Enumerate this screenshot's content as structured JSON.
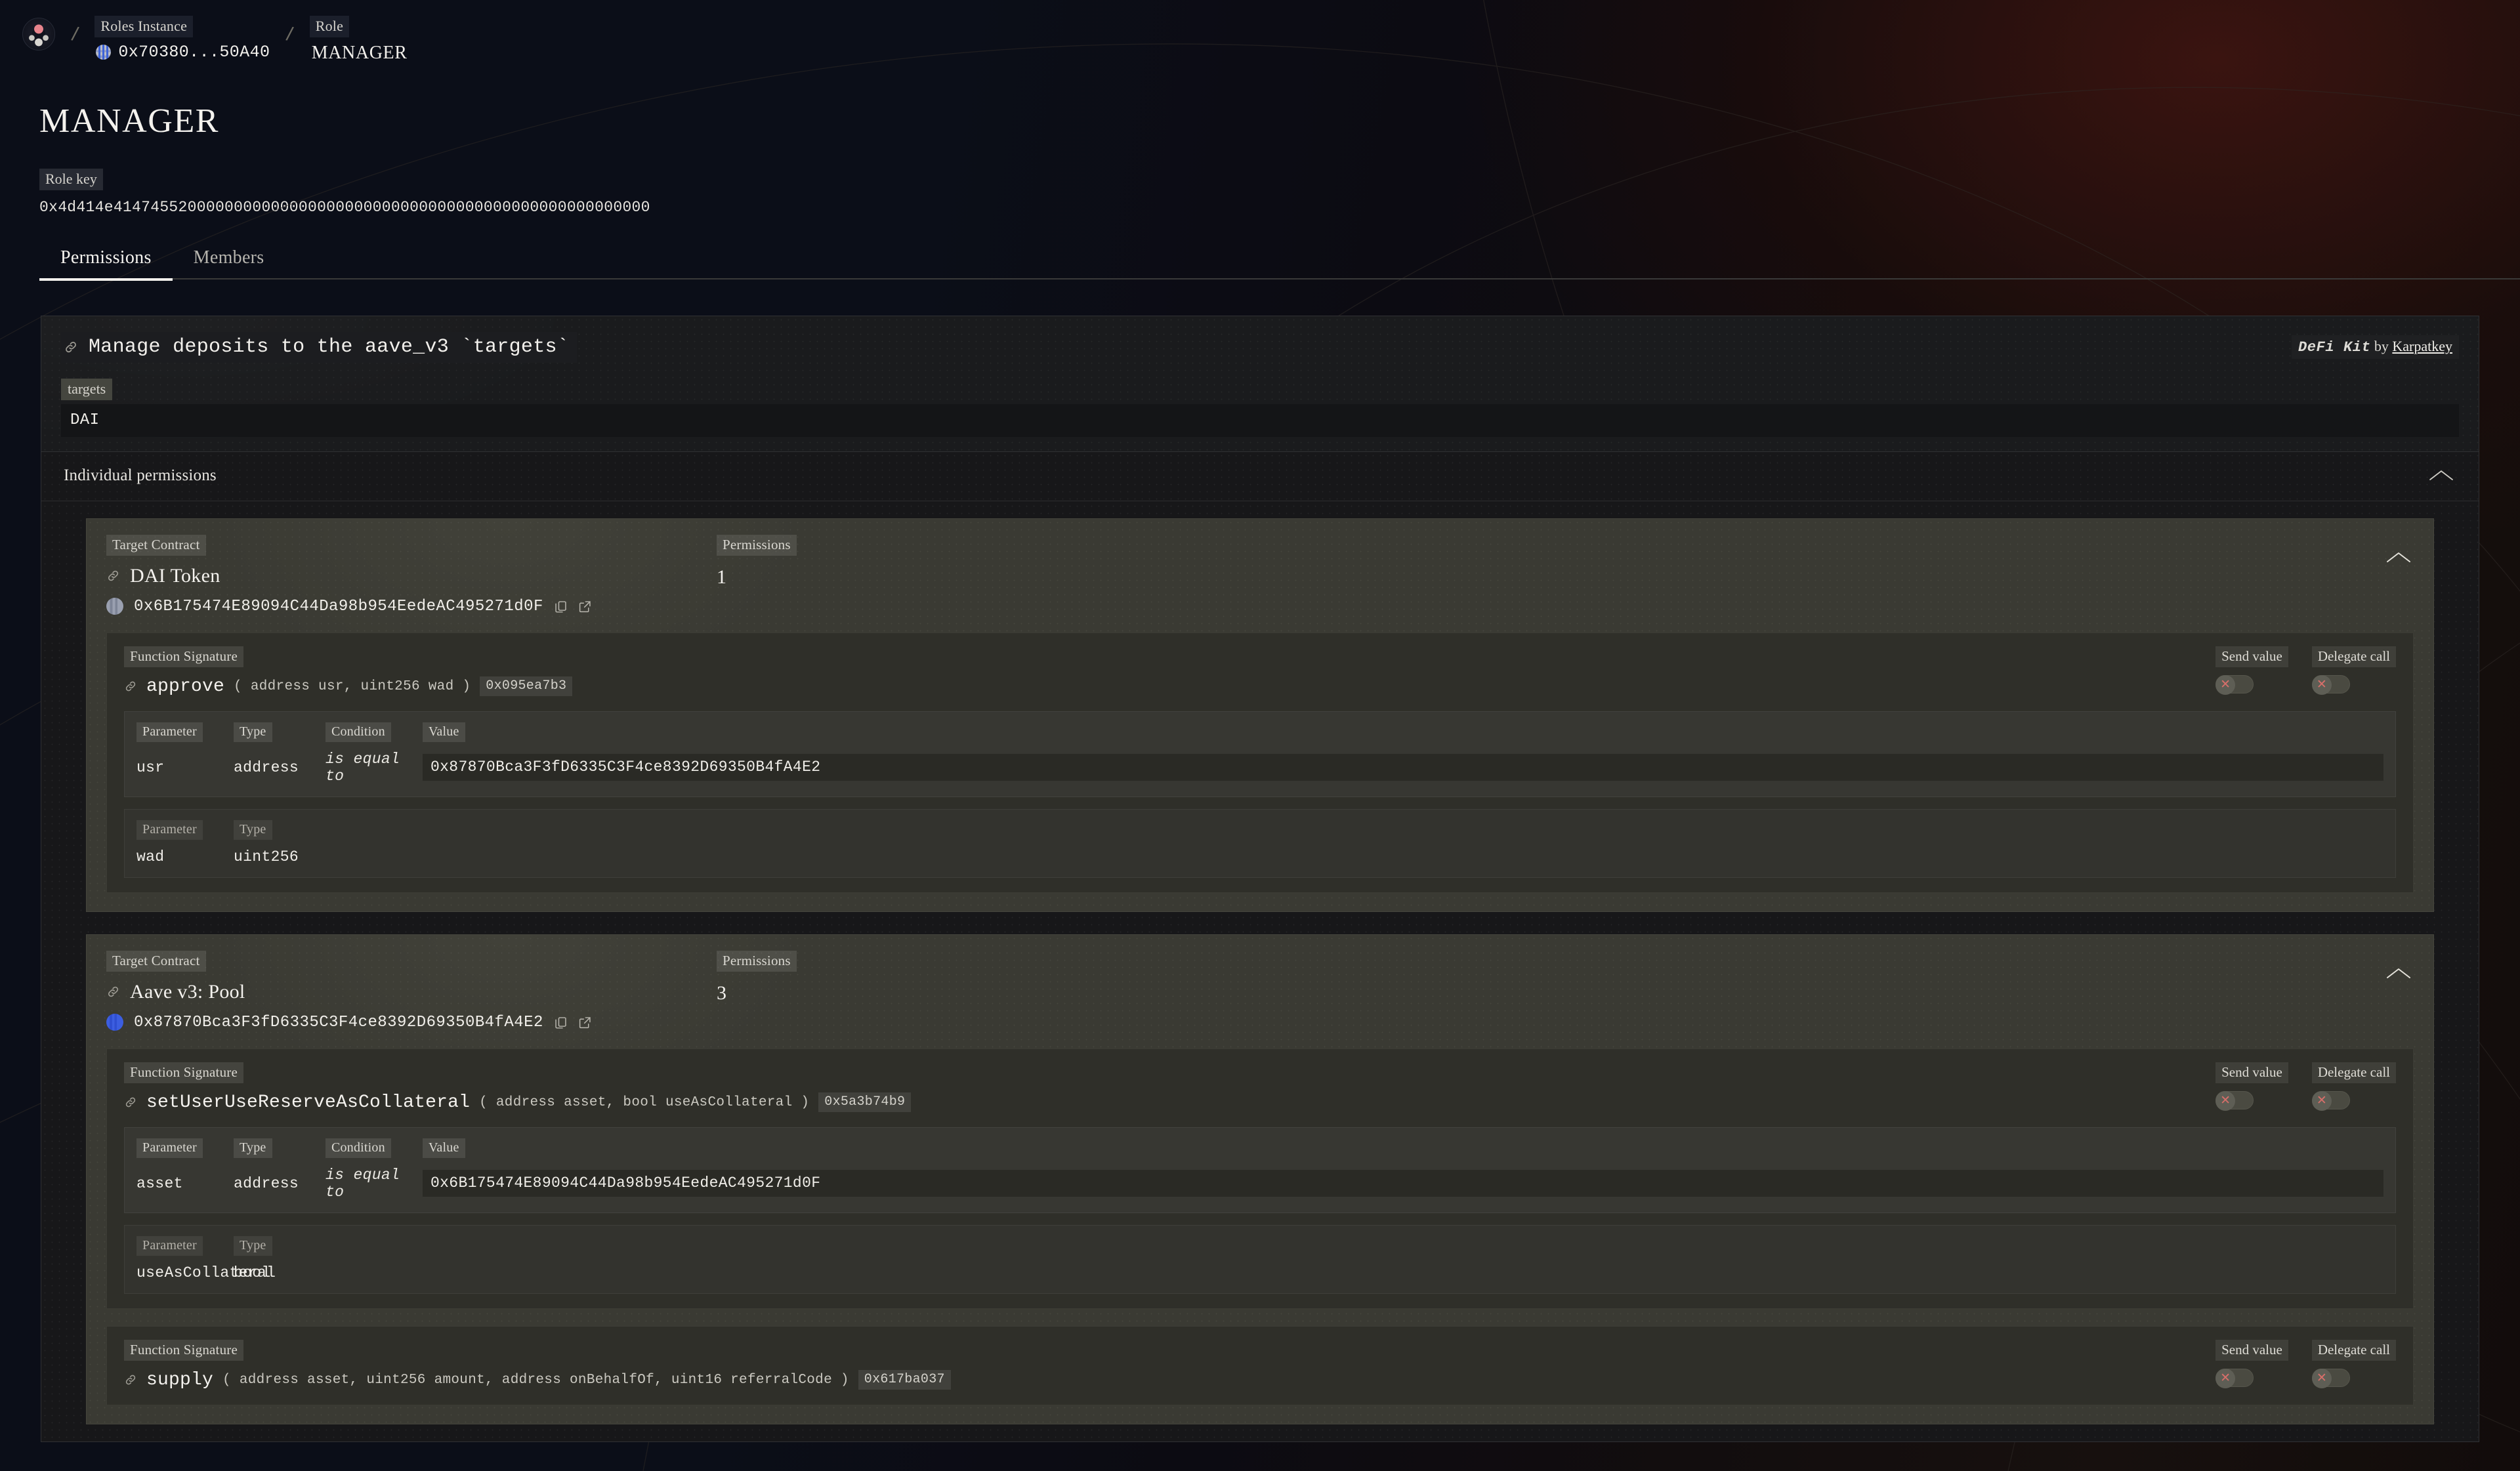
{
  "breadcrumb": {
    "logo_icon": "app-logo-icon",
    "items": [
      {
        "label": "Roles Instance",
        "value": "0x70380...50A40",
        "has_avatar": true
      },
      {
        "label": "Role",
        "value": "MANAGER",
        "has_avatar": false
      }
    ],
    "separator": "/"
  },
  "role": {
    "title": "MANAGER",
    "role_key_label": "Role key",
    "role_key_value": "0x4d414e4147455200000000000000000000000000000000000000000000000000"
  },
  "tabs": [
    {
      "label": "Permissions",
      "active": true
    },
    {
      "label": "Members",
      "active": false
    }
  ],
  "permission_card": {
    "title": "Manage deposits to the aave_v3 `targets`",
    "title_icon": "link-icon",
    "attribution": {
      "kit": "DeFi Kit",
      "by": "by",
      "author": "Karpatkey"
    },
    "targets_label": "targets",
    "targets_values": [
      "DAI"
    ]
  },
  "individual_permissions": {
    "label": "Individual permissions",
    "collapse_icon": "chevron-up-icon",
    "targets": [
      {
        "target_contract_label": "Target Contract",
        "name": "DAI Token",
        "name_icon": "link-icon",
        "address": "0x6B175474E89094C44Da98b954EedeAC495271d0F",
        "copy_icon": "copy-icon",
        "external_icon": "external-link-icon",
        "permissions_label": "Permissions",
        "permissions_count": "1",
        "collapse_icon": "chevron-up-icon",
        "functions": [
          {
            "signature_label": "Function Signature",
            "name": "approve",
            "args": "( address usr, uint256 wad )",
            "selector": "0x095ea7b3",
            "send_value": {
              "label": "Send value",
              "enabled": false,
              "icon": "x-icon"
            },
            "delegate_call": {
              "label": "Delegate call",
              "enabled": false,
              "icon": "x-icon"
            },
            "param_tables": [
              {
                "headers": {
                  "parameter": "Parameter",
                  "type": "Type",
                  "condition": "Condition",
                  "value": "Value"
                },
                "parameter": "usr",
                "type": "address",
                "condition": "is equal to",
                "value": "0x87870Bca3F3fD6335C3F4ce8392D69350B4fA4E2"
              },
              {
                "headers": {
                  "parameter": "Parameter",
                  "type": "Type"
                },
                "parameter": "wad",
                "type": "uint256",
                "condition": "",
                "value": ""
              }
            ]
          }
        ]
      },
      {
        "target_contract_label": "Target Contract",
        "name": "Aave v3: Pool",
        "name_icon": "link-icon",
        "address": "0x87870Bca3F3fD6335C3F4ce8392D69350B4fA4E2",
        "copy_icon": "copy-icon",
        "external_icon": "external-link-icon",
        "permissions_label": "Permissions",
        "permissions_count": "3",
        "collapse_icon": "chevron-up-icon",
        "functions": [
          {
            "signature_label": "Function Signature",
            "name": "setUserUseReserveAsCollateral",
            "args": "( address asset, bool useAsCollateral )",
            "selector": "0x5a3b74b9",
            "send_value": {
              "label": "Send value",
              "enabled": false,
              "icon": "x-icon"
            },
            "delegate_call": {
              "label": "Delegate call",
              "enabled": false,
              "icon": "x-icon"
            },
            "param_tables": [
              {
                "headers": {
                  "parameter": "Parameter",
                  "type": "Type",
                  "condition": "Condition",
                  "value": "Value"
                },
                "parameter": "asset",
                "type": "address",
                "condition": "is equal to",
                "value": "0x6B175474E89094C44Da98b954EedeAC495271d0F"
              },
              {
                "headers": {
                  "parameter": "Parameter",
                  "type": "Type"
                },
                "parameter": "useAsCollateral",
                "type": "bool",
                "condition": "",
                "value": ""
              }
            ]
          },
          {
            "signature_label": "Function Signature",
            "name": "supply",
            "args": "( address asset, uint256 amount, address onBehalfOf, uint16 referralCode )",
            "selector": "0x617ba037",
            "send_value": {
              "label": "Send value",
              "enabled": false,
              "icon": "x-icon"
            },
            "delegate_call": {
              "label": "Delegate call",
              "enabled": false,
              "icon": "x-icon"
            },
            "param_tables": []
          }
        ]
      }
    ]
  },
  "colors": {
    "page_bg_left": "#0b0e18",
    "page_bg_right": "#17100e",
    "card_bg": "#1a1b1d",
    "target_bg": "#3a3a33",
    "function_bg": "#2f2f29",
    "text_primary": "#f4f2ee",
    "accent_off": "#d86f6a",
    "tab_active_underline": "#f2f0ec"
  }
}
